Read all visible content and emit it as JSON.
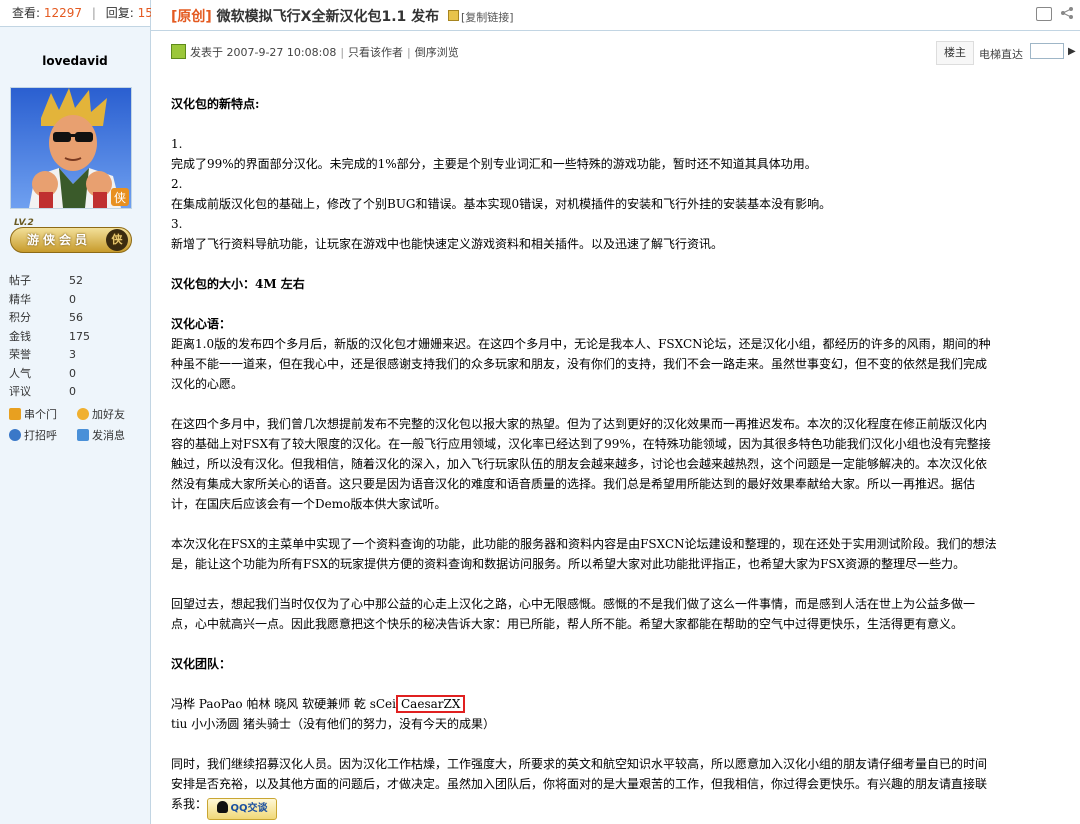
{
  "sidebar": {
    "views_label": "查看:",
    "views": "12297",
    "replies_label": "回复:",
    "replies": "15",
    "username": "lovedavid",
    "level": "LV.2",
    "rank": "游侠会员",
    "rank_emblem": "侠",
    "stats": [
      {
        "label": "帖子",
        "value": "52"
      },
      {
        "label": "精华",
        "value": "0"
      },
      {
        "label": "积分",
        "value": "56"
      },
      {
        "label": "金钱",
        "value": "175"
      },
      {
        "label": "荣誉",
        "value": "3"
      },
      {
        "label": "人气",
        "value": "0"
      },
      {
        "label": "评议",
        "value": "0"
      }
    ],
    "actions": [
      {
        "label": "串个门",
        "icon": "house-icon",
        "color": "#e8a020"
      },
      {
        "label": "加好友",
        "icon": "add-friend-icon",
        "color": "#f0b030"
      },
      {
        "label": "打招呼",
        "icon": "greet-icon",
        "color": "#3a78c8"
      },
      {
        "label": "发消息",
        "icon": "message-icon",
        "color": "#4a90d8"
      }
    ]
  },
  "header": {
    "tag": "[原创]",
    "title": "微软模拟飞行X全新汉化包1.1 发布",
    "copy_link": "[复制链接]"
  },
  "post_meta": {
    "posted_at": "发表于 2007-9-27 10:08:08",
    "only_author": "只看该作者",
    "reverse": "倒序浏览",
    "floor": "楼主",
    "jump_label": "电梯直达"
  },
  "post": {
    "h_features": "汉化包的新特点:",
    "f1_num": "1.",
    "f1": "完成了99%的界面部分汉化。未完成的1%部分，主要是个别专业词汇和一些特殊的游戏功能，暂时还不知道其具体功用。",
    "f2_num": "2.",
    "f2": "在集成前版汉化包的基础上，修改了个别BUG和错误。基本实现0错误，对机模插件的安装和飞行外挂的安装基本没有影响。",
    "f3_num": "3.",
    "f3": "新增了飞行资料导航功能，让玩家在游戏中也能快速定义游戏资料和相关插件。以及迅速了解飞行资讯。",
    "h_size": "汉化包的大小：4M 左右",
    "h_heart": "汉化心语：",
    "p1_l1": "距离1.0版的发布四个多月后，新版的汉化包才姗姗来迟。在这四个多月中，无论是我本人、FSXCN论坛，还是汉化小组，都经历的许多的风雨，期间的种",
    "p1_l2": "种虽不能一一道来，但在我心中，还是很感谢支持我们的众多玩家和朋友，没有你们的支持，我们不会一路走来。虽然世事变幻，但不变的依然是我们完成",
    "p1_l3": "汉化的心愿。",
    "p2_l1": "在这四个多月中，我们曾几次想提前发布不完整的汉化包以报大家的热望。但为了达到更好的汉化效果而一再推迟发布。本次的汉化程度在修正前版汉化内",
    "p2_l2": "容的基础上对FSX有了较大限度的汉化。在一般飞行应用领域，汉化率已经达到了99%，在特殊功能领域，因为其很多特色功能我们汉化小组也没有完整接",
    "p2_l3": "触过，所以没有汉化。但我相信，随着汉化的深入，加入飞行玩家队伍的朋友会越来越多，讨论也会越来越热烈，这个问题是一定能够解决的。本次汉化依",
    "p2_l4": "然没有集成大家所关心的语音。这只要是因为语音汉化的难度和语音质量的选择。我们总是希望用所能达到的最好效果奉献给大家。所以一再推迟。据估",
    "p2_l5": "计，在国庆后应该会有一个Demo版本供大家试听。",
    "p3_l1": "本次汉化在FSX的主菜单中实现了一个资料查询的功能，此功能的服务器和资料内容是由FSXCN论坛建设和整理的，现在还处于实用测试阶段。我们的想法",
    "p3_l2": "是，能让这个功能为所有FSX的玩家提供方便的资料查询和数据访问服务。所以希望大家对此功能批评指正，也希望大家为FSX资源的整理尽一些力。",
    "p4_l1": "回望过去，想起我们当时仅仅为了心中那公益的心走上汉化之路，心中无限感慨。感慨的不是我们做了这么一件事情，而是感到人活在世上为公益多做一",
    "p4_l2": "点，心中就高兴一点。因此我愿意把这个快乐的秘决告诉大家：用已所能，帮人所不能。希望大家都能在帮助的空气中过得更快乐，生活得更有意义。",
    "h_team": "汉化团队：",
    "team_l1": "冯桦 PaoPao 帕林 晓风 软硬兼师 乾 sCei",
    "team_highlight": "CaesarZX",
    "team_l2": "tiu 小小汤圆 猪头骑士（没有他们的努力，没有今天的成果）",
    "p5_l1": "同时，我们继续招募汉化人员。因为汉化工作枯燥，工作强度大，所要求的英文和航空知识水平较高，所以愿意加入汉化小组的朋友请仔细考量自已的时间",
    "p5_l2": "安排是否充裕，以及其他方面的问题后，才做决定。虽然加入团队后，你将面对的是大量艰苦的工作，但我相信，你过得会更快乐。有兴趣的朋友请直接联",
    "p5_l3": "系我：",
    "qq_button": "QQ交谈"
  }
}
